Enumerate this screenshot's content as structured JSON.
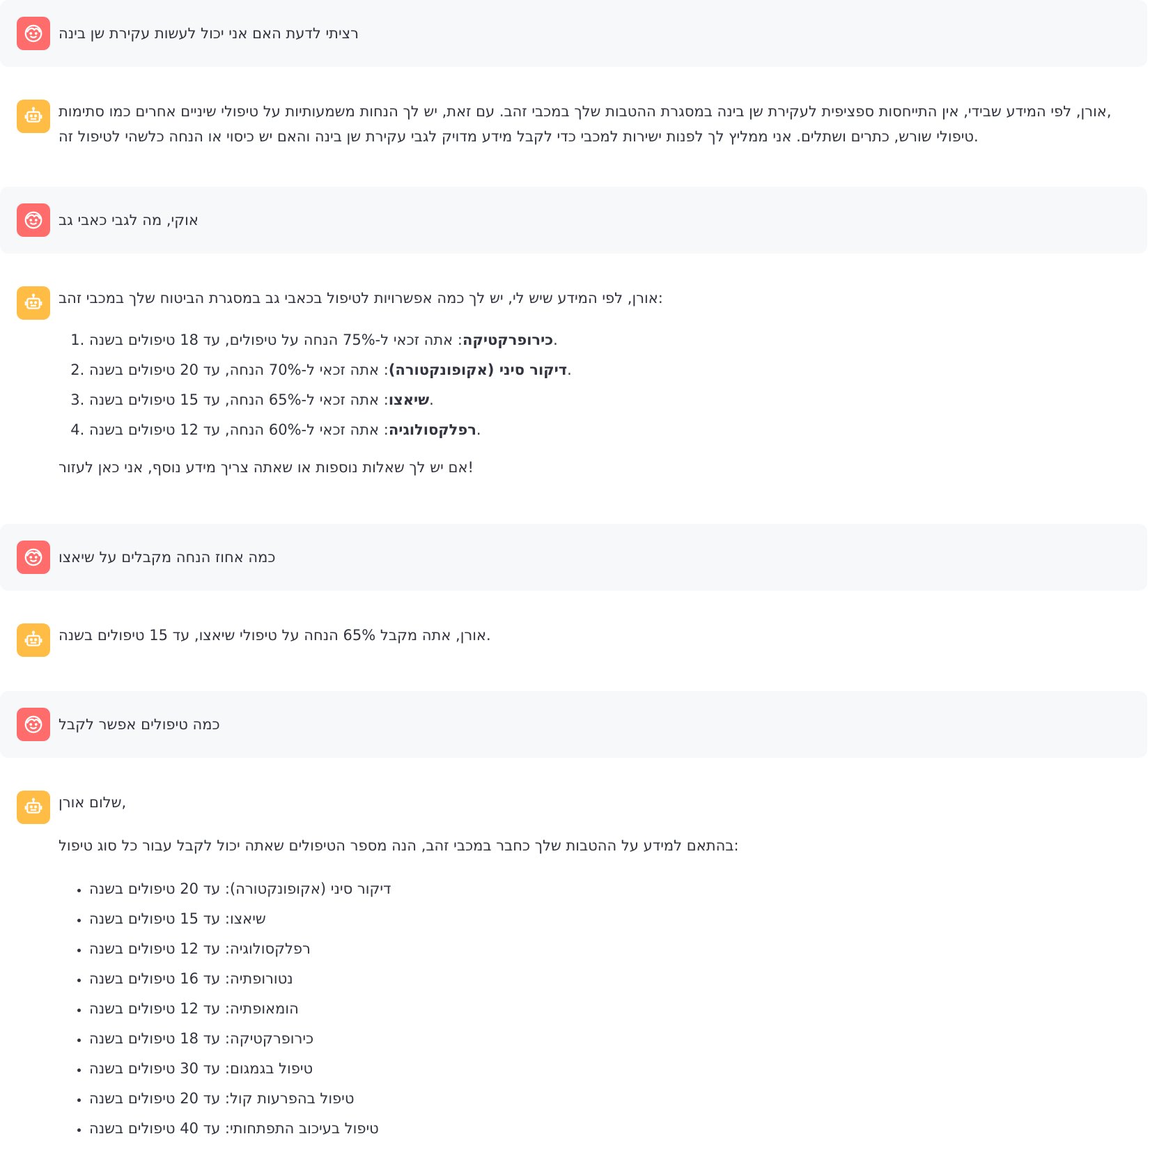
{
  "colors": {
    "user_avatar": "#ff6c6c",
    "assistant_avatar": "#ffbd45",
    "user_bubble": "#f7f8fa",
    "text": "#31333f"
  },
  "icons": {
    "user": "smiling-face-icon",
    "assistant": "robot-face-icon"
  },
  "messages": [
    {
      "role": "user",
      "text": "רציתי לדעת האם אני יכול לעשות עקירת שן בינה"
    },
    {
      "role": "assistant",
      "lines": [
        "אורן, לפי המידע שבידי, אין התייחסות ספציפית לעקירת שן בינה במסגרת ההטבות שלך במכבי זהב. עם זאת, יש לך הנחות משמעותיות על טיפולי שיניים אחרים כמו סתימות,",
        "טיפולי שורש, כתרים ושתלים. אני ממליץ לך לפנות ישירות למכבי כדי לקבל מידע מדויק לגבי עקירת שן בינה והאם יש כיסוי או הנחה כלשהי לטיפול זה."
      ]
    },
    {
      "role": "user",
      "text": "אוקי, מה לגבי כאבי גב"
    },
    {
      "role": "assistant",
      "intro": "אורן, לפי המידע שיש לי, יש לך כמה אפשרויות לטיפול בכאבי גב במסגרת הביטוח שלך במכבי זהב:",
      "items": [
        {
          "bold": "כירופרקטיקה",
          "rest": ": אתה זכאי ל-75% הנחה על טיפולים, עד 18 טיפולים בשנה."
        },
        {
          "bold": "דיקור סיני (אקופונקטורה)",
          "rest": ": אתה זכאי ל-70% הנחה, עד 20 טיפולים בשנה."
        },
        {
          "bold": "שיאצו",
          "rest": ": אתה זכאי ל-65% הנחה, עד 15 טיפולים בשנה."
        },
        {
          "bold": "רפלקסולוגיה",
          "rest": ": אתה זכאי ל-60% הנחה, עד 12 טיפולים בשנה."
        }
      ],
      "outro": "אם יש לך שאלות נוספות או שאתה צריך מידע נוסף, אני כאן לעזור!"
    },
    {
      "role": "user",
      "text": "כמה אחוז הנחה מקבלים על שיאצו"
    },
    {
      "role": "assistant",
      "text": "אורן, אתה מקבל 65% הנחה על טיפולי שיאצו, עד 15 טיפולים בשנה."
    },
    {
      "role": "user",
      "text": "כמה טיפולים אפשר לקבל"
    },
    {
      "role": "assistant",
      "greeting": "שלום אורן,",
      "intro": "בהתאם למידע על ההטבות שלך כחבר במכבי זהב, הנה מספר הטיפולים שאתה יכול לקבל עבור כל סוג טיפול:",
      "bullets": [
        "דיקור סיני (אקופונקטורה): עד 20 טיפולים בשנה",
        "שיאצו: עד 15 טיפולים בשנה",
        "רפלקסולוגיה: עד 12 טיפולים בשנה",
        "נטורופתיה: עד 16 טיפולים בשנה",
        "הומאופתיה: עד 12 טיפולים בשנה",
        "כירופרקטיקה: עד 18 טיפולים בשנה",
        "טיפול בגמגום: עד 30 טיפולים בשנה",
        "טיפול בהפרעות קול: עד 20 טיפולים בשנה",
        "טיפול בעיכוב התפתחותי: עד 40 טיפולים בשנה"
      ]
    }
  ]
}
